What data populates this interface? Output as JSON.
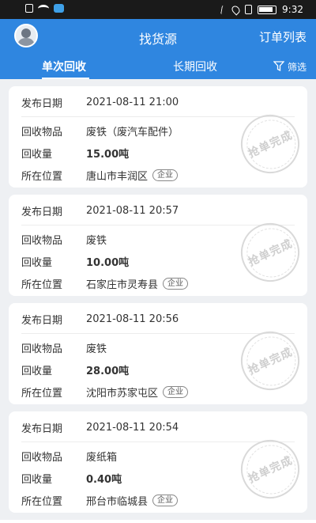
{
  "status": {
    "time": "9:32"
  },
  "header": {
    "title": "找货源",
    "orders_label": "订单列表",
    "tabs": [
      {
        "label": "单次回收"
      },
      {
        "label": "长期回收"
      }
    ],
    "filter_label": "筛选"
  },
  "colors": {
    "accent": "#2f86e0",
    "background": "#eef0f3",
    "card": "#ffffff"
  },
  "labels": {
    "date": "发布日期",
    "item": "回收物品",
    "qty": "回收量",
    "loc": "所在位置",
    "tag": "企业",
    "stamp": "抢单完成"
  },
  "orders": [
    {
      "date": "2021-08-11 21:00",
      "item": "废铁（废汽车配件）",
      "qty": "15.00吨",
      "loc": "唐山市丰润区"
    },
    {
      "date": "2021-08-11 20:57",
      "item": "废铁",
      "qty": "10.00吨",
      "loc": "石家庄市灵寿县"
    },
    {
      "date": "2021-08-11 20:56",
      "item": "废铁",
      "qty": "28.00吨",
      "loc": "沈阳市苏家屯区"
    },
    {
      "date": "2021-08-11 20:54",
      "item": "废纸箱",
      "qty": "0.40吨",
      "loc": "邢台市临城县"
    }
  ]
}
